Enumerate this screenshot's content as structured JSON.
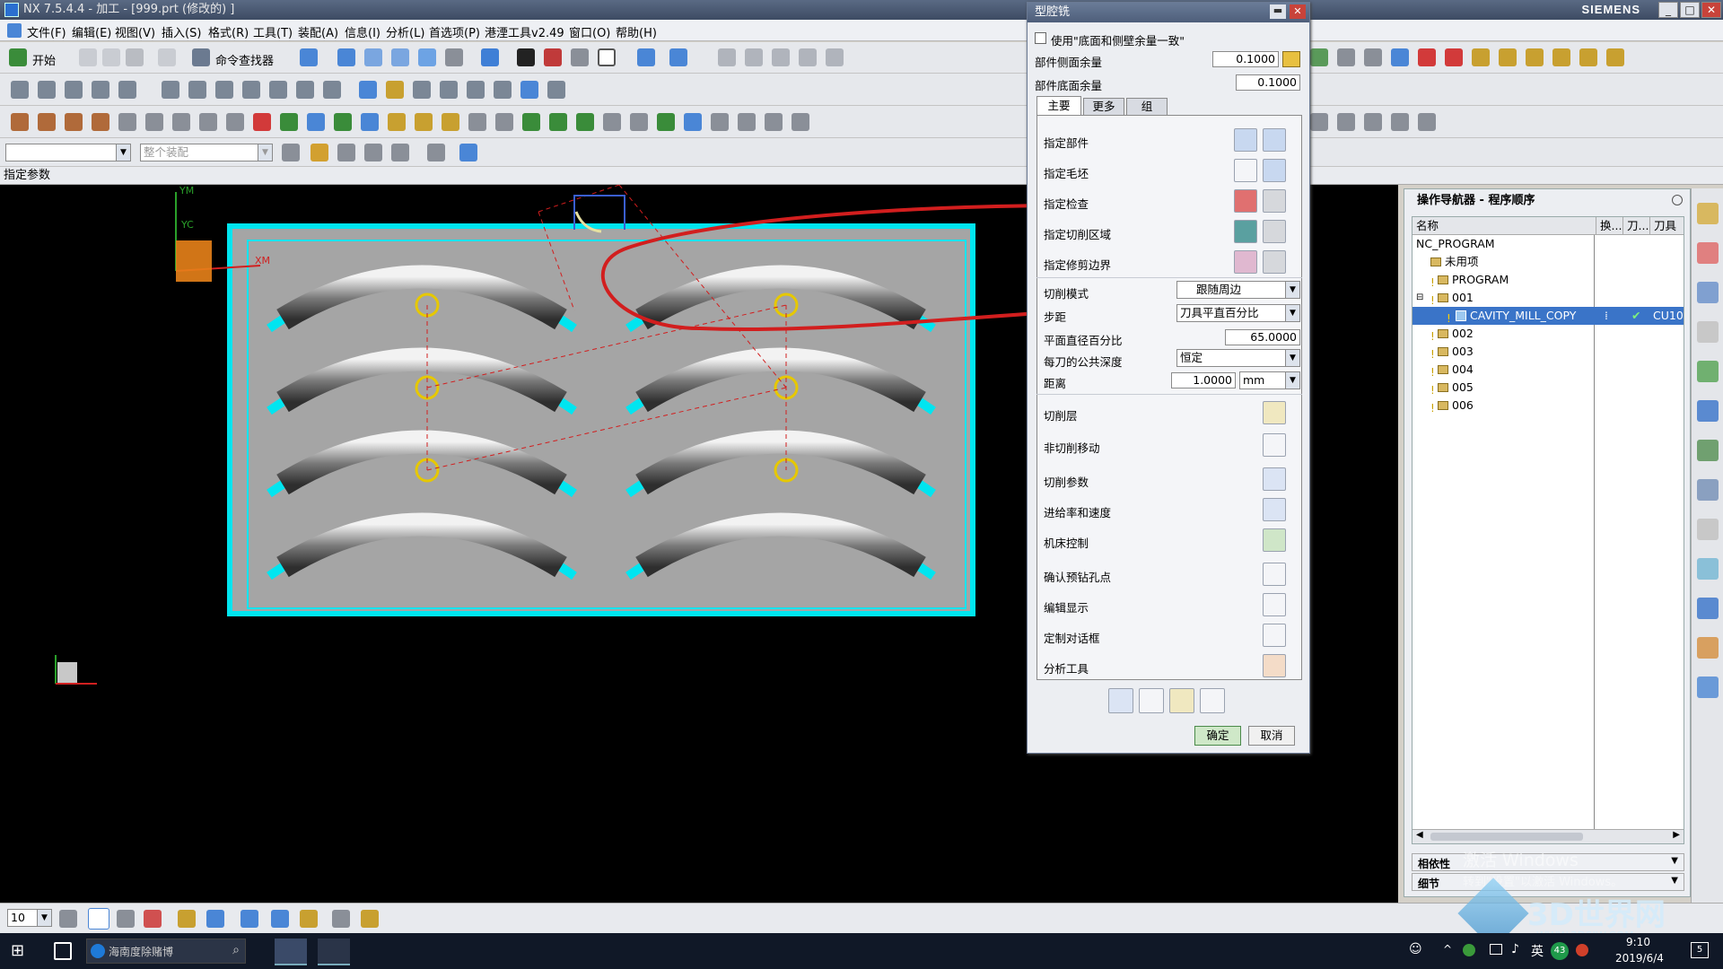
{
  "window": {
    "title": "NX 7.5.4.4 - 加工 - [999.prt  (修改的)  ]",
    "brand": "SIEMENS"
  },
  "menu": [
    "文件(F)",
    "编辑(E)",
    "视图(V)",
    "插入(S)",
    "格式(R)",
    "工具(T)",
    "装配(A)",
    "信息(I)",
    "分析(L)",
    "首选项(P)",
    "港湮工具v2.49",
    "窗口(O)",
    "帮助(H)"
  ],
  "toolbar": {
    "start_label": "开始",
    "cmd_finder_label": "命令查找器",
    "assembly_placeholder": "整个装配"
  },
  "status": {
    "prompt": "指定参数"
  },
  "dialog": {
    "title": "型腔铣",
    "checkbox_label": "使用\"底面和侧壁余量一致\"",
    "side_stock_label": "部件侧面余量",
    "side_stock_value": "0.1000",
    "floor_stock_label": "部件底面余量",
    "floor_stock_value": "0.1000",
    "tabs": [
      "主要",
      "更多",
      "组"
    ],
    "geometry": [
      "指定部件",
      "指定毛坯",
      "指定检查",
      "指定切削区域",
      "指定修剪边界"
    ],
    "cut_pattern_label": "切削模式",
    "cut_pattern_value": "跟随周边",
    "stepover_label": "步距",
    "stepover_value": "刀具平直百分比",
    "percent_label": "平面直径百分比",
    "percent_value": "65.0000",
    "depth_label": "每刀的公共深度",
    "depth_value": "恒定",
    "distance_label": "距离",
    "distance_value": "1.0000",
    "distance_unit": "mm",
    "options": [
      "切削层",
      "非切削移动",
      "切削参数",
      "进给率和速度",
      "机床控制",
      "确认预钻孔点",
      "编辑显示",
      "定制对话框",
      "分析工具"
    ],
    "ok_label": "确定",
    "cancel_label": "取消"
  },
  "navigator": {
    "title": "操作导航器 - 程序顺序",
    "columns": [
      "名称",
      "换...",
      "刀...",
      "刀具"
    ],
    "items": [
      "NC_PROGRAM",
      "未用项",
      "PROGRAM",
      "001",
      "CAVITY_MILL_COPY",
      "002",
      "003",
      "004",
      "005",
      "006"
    ],
    "selected_tool": "CU10",
    "dependency_label": "相依性",
    "details_label": "细节"
  },
  "viewport": {
    "axis_labels": [
      "YM",
      "YC",
      "XM",
      "XC"
    ]
  },
  "bottombar": {
    "layer_value": "10"
  },
  "watermark": {
    "line1": "激活 Windows",
    "line2": "转到\"设置\"以激活 Windows。",
    "brand": "3D世界网",
    "url": "WWW.3DSJW.COM"
  },
  "taskbar": {
    "search_placeholder": "海南度除赌博",
    "ime": "英",
    "time": "9:10",
    "date": "2019/6/4",
    "badge": "43",
    "notif": "5"
  },
  "colors": {
    "accent": "#3a74c8",
    "viewport_bg": "#000000",
    "part_gray": "#a5a5a5",
    "toolpath": "#00e5f0",
    "sketch_red": "#d21e1e"
  }
}
